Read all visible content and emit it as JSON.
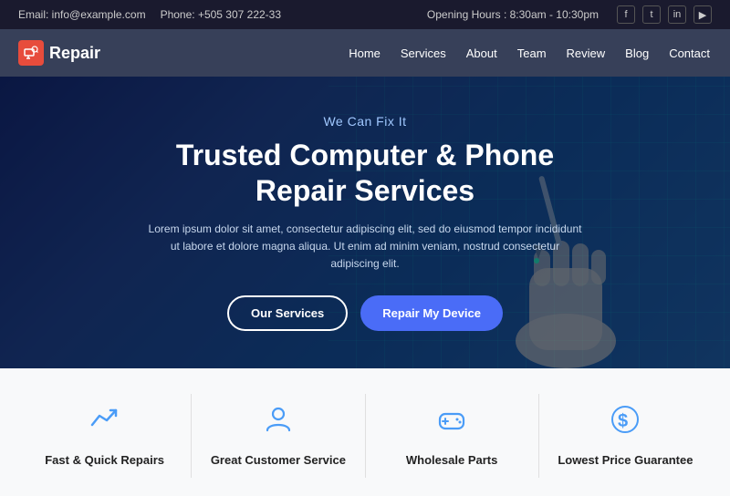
{
  "topbar": {
    "email_label": "Email: info@example.com",
    "phone_label": "Phone: +505 307 222-33",
    "opening_label": "Opening Hours : 8:30am - 10:30pm",
    "social": [
      "f",
      "t",
      "in",
      "yt"
    ]
  },
  "header": {
    "logo_text": "Repair",
    "nav_items": [
      "Home",
      "Services",
      "About",
      "Team",
      "Review",
      "Blog",
      "Contact"
    ]
  },
  "hero": {
    "subtitle": "We Can Fix It",
    "title": "Trusted Computer & Phone Repair Services",
    "description": "Lorem ipsum dolor sit amet, consectetur adipiscing elit, sed do eiusmod tempor incididunt ut labore et dolore magna aliqua. Ut enim ad minim veniam, nostrud consectetur adipiscing elit.",
    "btn_services": "Our Services",
    "btn_repair": "Repair My Device"
  },
  "services": [
    {
      "label": "Fast & Quick Repairs",
      "icon": "fast-repairs-icon"
    },
    {
      "label": "Great Customer Service",
      "icon": "customer-service-icon"
    },
    {
      "label": "Wholesale Parts",
      "icon": "wholesale-parts-icon"
    },
    {
      "label": "Lowest Price Guarantee",
      "icon": "price-guarantee-icon"
    }
  ]
}
